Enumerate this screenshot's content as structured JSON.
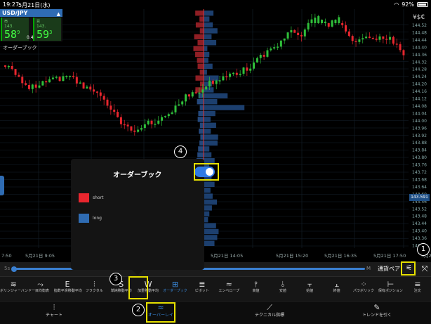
{
  "status": {
    "time": "19:27",
    "date": "5月21日(水)",
    "battery": "92%"
  },
  "pair": {
    "name": "USD/JPY",
    "sell_label": "売",
    "buy_label": "買",
    "sell_prefix": "143.",
    "sell_pips": "58",
    "sell_frac": "9",
    "buy_prefix": "143.",
    "buy_pips": "59",
    "buy_frac": "3",
    "spread": "0.4"
  },
  "overlay_label": "オーダーブック",
  "currency_icon": "¥$€",
  "current_price": "143.591",
  "price_axis": [
    "144.52",
    "144.48",
    "144.44",
    "144.40",
    "144.36",
    "144.32",
    "144.28",
    "144.24",
    "144.20",
    "144.16",
    "144.12",
    "144.08",
    "144.04",
    "144.00",
    "143.96",
    "143.92",
    "143.88",
    "143.84",
    "143.80",
    "143.76",
    "143.72",
    "143.68",
    "143.64",
    "143.60",
    "143.56",
    "143.52",
    "143.48",
    "143.44",
    "143.40",
    "143.36",
    "143.32"
  ],
  "time_axis": [
    "7:50",
    "5月21日 9:05",
    "5月21日 14:05",
    "5月21日 15:20",
    "5月21日 16:35",
    "5月21日 17:50",
    "5月21日"
  ],
  "timeline": {
    "left": "5s",
    "right": "M",
    "currency_pair": "通貨ペア"
  },
  "popup": {
    "title": "オーダーブック",
    "toggle_on": true,
    "legend": [
      {
        "label": "short",
        "color": "#e8262e"
      },
      {
        "label": "long",
        "color": "#2f6cb3"
      }
    ]
  },
  "annotations": [
    "1",
    "2",
    "3",
    "4"
  ],
  "tools": [
    {
      "label": "ボリンジャーバンド",
      "icon": "≋"
    },
    {
      "label": "一目均衡表",
      "icon": "⤳"
    },
    {
      "label": "指数平滑移動平均",
      "icon": "E"
    },
    {
      "label": "フラクタル",
      "icon": "⫶"
    },
    {
      "label": "単純移動平均",
      "icon": "S"
    },
    {
      "label": "加重移動平均",
      "icon": "W"
    },
    {
      "label": "オーダーブック",
      "icon": "⊞",
      "active": true
    },
    {
      "label": "ピボット",
      "icon": "≣"
    },
    {
      "label": "エンベロープ",
      "icon": "≈"
    },
    {
      "label": "高値",
      "icon": "⫯"
    },
    {
      "label": "安値",
      "icon": "⫰"
    },
    {
      "label": "始値",
      "icon": "⫟"
    },
    {
      "label": "終値",
      "icon": "⫠"
    },
    {
      "label": "パラボリック",
      "icon": "⁘"
    },
    {
      "label": "保有ポジション",
      "icon": "⊢"
    },
    {
      "label": "注文",
      "icon": "≡"
    }
  ],
  "nav": [
    {
      "label": "チャート",
      "icon": "⫶"
    },
    {
      "label": "オーバーレイ",
      "icon": "≈",
      "active": true
    },
    {
      "label": "テクニカル指標",
      "icon": "⟋"
    },
    {
      "label": "トレンドを引く",
      "icon": "✎"
    }
  ],
  "colors": {
    "up": "#2fbf3a",
    "down": "#e8262e",
    "accent": "#2f7ae5",
    "highlight": "#e6e000"
  }
}
